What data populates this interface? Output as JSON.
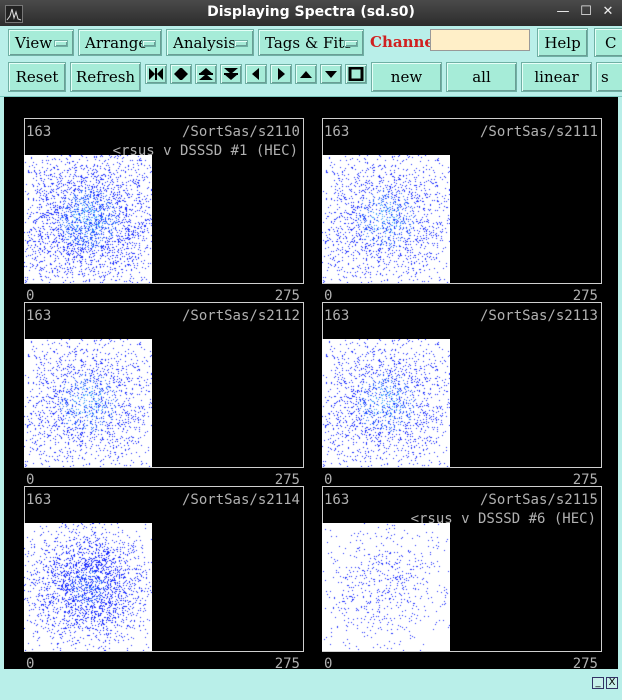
{
  "window": {
    "title": "Displaying Spectra (sd.s0)"
  },
  "toolbar": {
    "menus": [
      "View",
      "Arrange",
      "Analysis",
      "Tags & Fits"
    ],
    "channel_label": "Channel:",
    "channel_value": "",
    "help_label": "Help",
    "cut_label": "C",
    "reset_label": "Reset",
    "refresh_label": "Refresh",
    "new_label": "new",
    "all_label": "all",
    "linear_label": "linear",
    "s_label": "s"
  },
  "nav_icons": [
    "zoom-in-x-icon",
    "zoom-out-x-icon",
    "zoom-in-y-icon",
    "zoom-out-y-icon",
    "scroll-left-icon",
    "scroll-right-icon",
    "scroll-up-icon",
    "scroll-down-icon",
    "full-view-icon"
  ],
  "colors": {
    "accent": "#a6ecd8",
    "background": "#b9efe9",
    "channel_label": "#d02020",
    "display_bg": "#000000",
    "point_color": "#1a2cff"
  },
  "panels": [
    {
      "count": "163",
      "name": "/SortSas/s2110",
      "subtitle": "<rsus v DSSSD #1 (HEC)",
      "x_min": "0",
      "x_max": "275",
      "density": "high",
      "line": false
    },
    {
      "count": "163",
      "name": "/SortSas/s2111",
      "subtitle": "",
      "x_min": "0",
      "x_max": "275",
      "density": "high",
      "line": true
    },
    {
      "count": "163",
      "name": "/SortSas/s2112",
      "subtitle": "",
      "x_min": "0",
      "x_max": "275",
      "density": "high",
      "line": true
    },
    {
      "count": "163",
      "name": "/SortSas/s2113",
      "subtitle": "",
      "x_min": "0",
      "x_max": "275",
      "density": "high",
      "line": false
    },
    {
      "count": "163",
      "name": "/SortSas/s2114",
      "subtitle": "",
      "x_min": "0",
      "x_max": "275",
      "density": "medium",
      "line": false
    },
    {
      "count": "163",
      "name": "/SortSas/s2115",
      "subtitle": "<rsus v DSSSD #6 (HEC)",
      "x_min": "0",
      "x_max": "275",
      "density": "low",
      "line": false
    }
  ],
  "statusbar": {
    "minimize_label": "_",
    "close_label": "X"
  }
}
